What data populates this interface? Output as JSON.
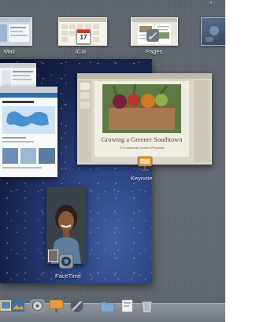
{
  "spaces": [
    {
      "label": "Mail",
      "icon": "mail-thumbnail"
    },
    {
      "label": "iCal",
      "icon": "ical-thumbnail"
    },
    {
      "label": "Pages",
      "icon": "pages-thumbnail"
    }
  ],
  "calendar_icon_day": "17",
  "apps": {
    "keynote": {
      "label": "Keynote"
    },
    "facetime": {
      "label": "FaceTime"
    }
  },
  "keynote_slide": {
    "title": "Growing a Greener Southtown",
    "subtitle": "A Community Garden Proposal"
  },
  "dock": {
    "items": [
      {
        "name": "iphoto-dock-icon"
      },
      {
        "name": "system-preferences-dock-icon"
      },
      {
        "name": "keynote-dock-icon"
      },
      {
        "name": "aperture-dock-icon"
      },
      {
        "name": "documents-folder-dock-icon"
      },
      {
        "name": "downloads-stack-dock-icon"
      },
      {
        "name": "trash-dock-icon"
      }
    ]
  },
  "colors": {
    "desktop_background": "#2a3f7c",
    "panel_background": "#60666d",
    "keynote_chrome": "#dad5c8"
  }
}
